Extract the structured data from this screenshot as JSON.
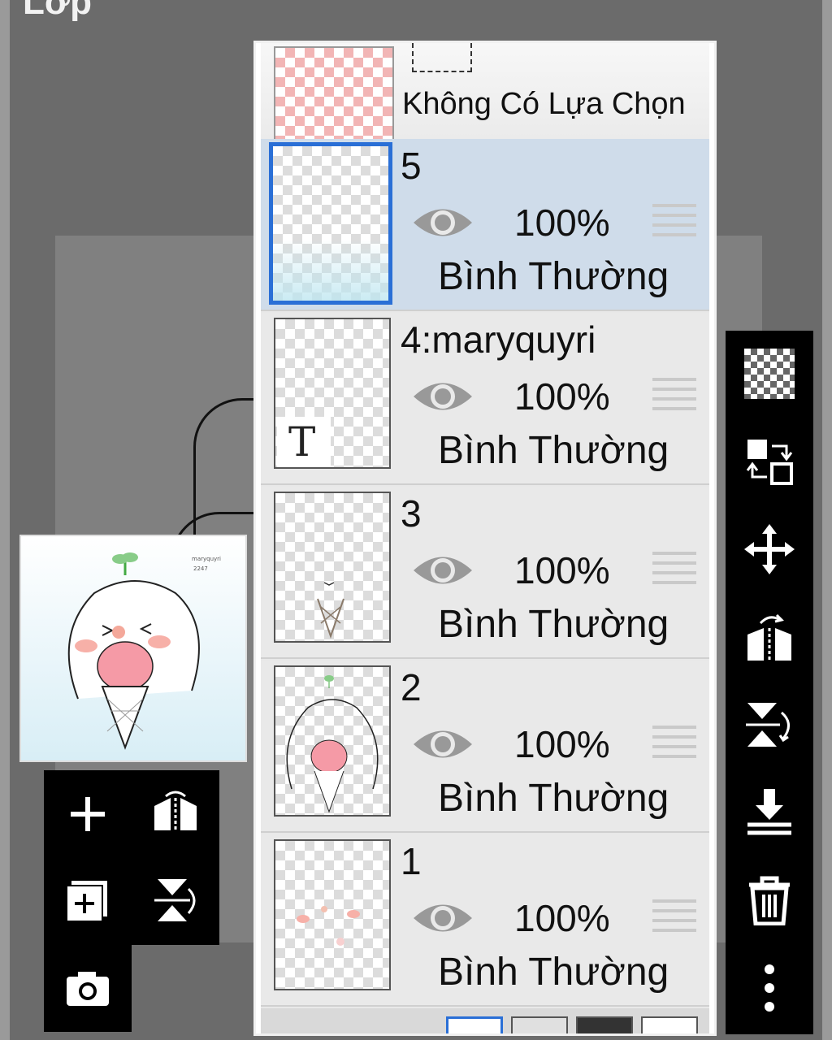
{
  "header": {
    "title": "Lớp"
  },
  "selection": {
    "label": "Không Có Lựa Chọn"
  },
  "layers": [
    {
      "name": "5",
      "opacity": "100%",
      "blend": "Bình Thường",
      "active": true
    },
    {
      "name": "4:maryquyri",
      "opacity": "100%",
      "blend": "Bình Thường",
      "active": false
    },
    {
      "name": "3",
      "opacity": "100%",
      "blend": "Bình Thường",
      "active": false
    },
    {
      "name": "2",
      "opacity": "100%",
      "blend": "Bình Thường",
      "active": false
    },
    {
      "name": "1",
      "opacity": "100%",
      "blend": "Bình Thường",
      "active": false
    }
  ],
  "text_layer_glyph": "T",
  "left_toolbar": [
    "add-layer-icon",
    "flip-horizontal-icon",
    "add-copy-layer-icon",
    "flip-vertical-icon",
    "camera-icon"
  ],
  "right_toolbar": [
    "transparency-icon",
    "swap-layers-icon",
    "move-icon",
    "rotate-flip-icon",
    "flip-rotate-vertical-icon",
    "merge-down-icon",
    "trash-icon",
    "more-icon"
  ],
  "colors": {
    "active_layer_bg": "#cfdcea",
    "active_border": "#2a6fd6",
    "toolbar_bg": "#000000"
  }
}
